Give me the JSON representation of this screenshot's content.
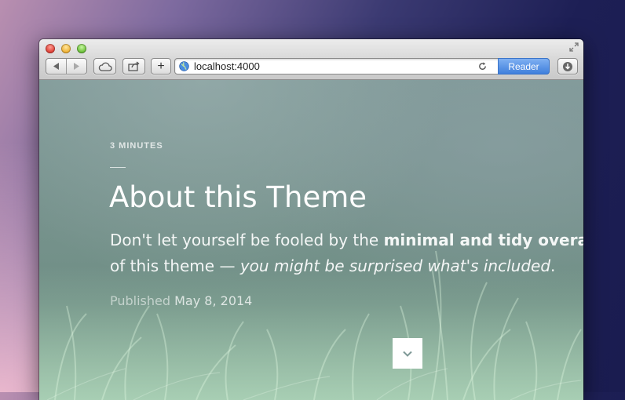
{
  "browser": {
    "url": "localhost:4000",
    "reader_label": "Reader",
    "add_tab_symbol": "+"
  },
  "post": {
    "read_time": "3 MINUTES",
    "title": "About this Theme",
    "lead_part1": "Don't let yourself be fooled by the ",
    "lead_bold": "minimal and tidy overal",
    "lead_part2": "of this theme — ",
    "lead_italic": "you might be surprised what's included",
    "lead_end": ".",
    "published_label": "Published ",
    "published_date": "May 8, 2014"
  },
  "colors": {
    "reader_accent": "#4a87e0",
    "background_top": "#7f9997",
    "background_bottom": "#7fa592"
  },
  "icons": {
    "back": "back-arrow-icon",
    "forward": "forward-arrow-icon",
    "cloud": "icloud-tabs-icon",
    "share": "share-icon",
    "globe": "globe-icon",
    "reload": "reload-icon",
    "download": "downloads-icon",
    "scroll": "chevron-down-icon"
  }
}
